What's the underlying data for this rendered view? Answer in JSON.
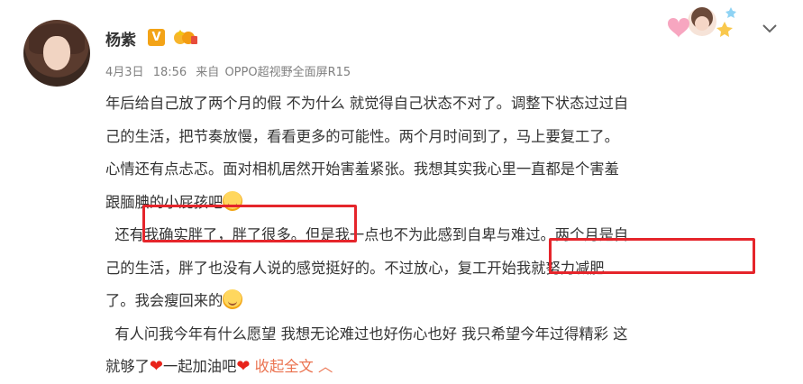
{
  "post": {
    "username": "杨紫",
    "verified_badge": "V",
    "meta": {
      "date": "4月3日",
      "time": "18:56",
      "from_label": "来自",
      "device": "OPPO超视野全面屏R15"
    },
    "lines": [
      "年后给自己放了两个月的假 不为什么 就觉得自己状态不对了。调整下状态过过自",
      "己的生活，把节奏放慢，看看更多的可能性。两个月时间到了，马上要复工了。",
      "心情还有点忐忑。面对相机居然开始害羞紧张。我想其实我心里一直都是个害羞",
      "跟腼腆的小屁孩吧",
      "  还有我确实胖了，胖了很多。但是我一点也不为此感到自卑与难过。两个月是自",
      "己的生活，胖了也没有人说的感觉挺好的。不过放心，复工开始我就努力减肥",
      "了。我会瘦回来的",
      "  有人问我今年有什么愿望 我想无论难过也好伤心也好 我只希望今年过得精彩 这",
      "就够了"
    ],
    "last_line_middle": "一起加油吧",
    "collapse_label": "收起全文",
    "collapse_arrow": "︿",
    "heart_glyph": "❤"
  },
  "icons": {
    "avatar": "user-avatar-photo",
    "crown": "crown-badge-icon",
    "deco": "avatar-sticker-decoration",
    "chevron": "chevron-down-icon",
    "emoji_blush": "blush-emoji-icon",
    "emoji_yawn": "yawn-emoji-icon"
  },
  "colors": {
    "highlight_box": "#e5252b",
    "link": "#eb7350",
    "heart": "#e8231a",
    "meta_text": "#808080",
    "verified": "#f3a317"
  }
}
